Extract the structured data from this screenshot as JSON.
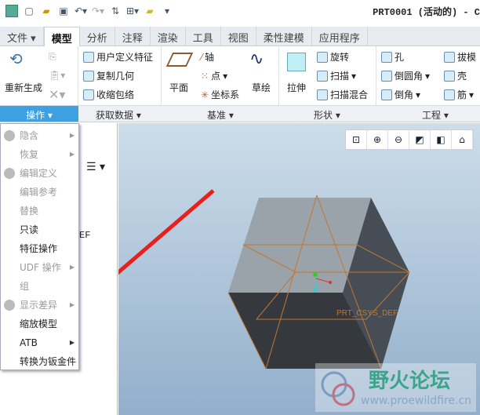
{
  "window": {
    "title": "PRT0001 (活动的) - C"
  },
  "tabs": [
    "文件",
    "模型",
    "分析",
    "注释",
    "渲染",
    "工具",
    "视图",
    "柔性建模",
    "应用程序"
  ],
  "ribbon": {
    "regen": "重新生成",
    "get_data": [
      "用户定义特征",
      "复制几何",
      "收缩包络"
    ],
    "datum": {
      "plane": "平面",
      "axis": "轴",
      "point": "点",
      "csys": "坐标系",
      "sketch": "草绘"
    },
    "shape": {
      "extrude": "拉伸",
      "revolve": "旋转",
      "sweep": "扫描",
      "swept_blend": "扫描混合"
    },
    "eng": {
      "hole": "孔",
      "round": "倒圆角",
      "chamfer": "倒角",
      "draft": "拔模",
      "shell": "壳",
      "rib": "筋"
    }
  },
  "groups": [
    "操作",
    "获取数据",
    "基准",
    "形状",
    "工程"
  ],
  "menu": [
    {
      "label": "隐含",
      "disabled": true,
      "sub": true
    },
    {
      "label": "恢复",
      "disabled": true,
      "sub": true
    },
    {
      "label": "编辑定义",
      "disabled": true
    },
    {
      "label": "编辑参考",
      "disabled": true
    },
    {
      "label": "替换",
      "disabled": true
    },
    {
      "label": "只读"
    },
    {
      "label": "特征操作"
    },
    {
      "label": "UDF 操作",
      "disabled": true,
      "sub": true
    },
    {
      "label": "组",
      "disabled": true
    },
    {
      "label": "显示差异",
      "disabled": true,
      "sub": true
    },
    {
      "label": "缩放模型"
    },
    {
      "label": "ATB",
      "sub": true
    },
    {
      "label": "转换为钣金件"
    }
  ],
  "tree": {
    "partial_text": "EF"
  },
  "viewport": {
    "csys_label": "PRT_CSYS_DEF"
  },
  "watermark": {
    "title": "野火论坛",
    "url": "www.proewildfire.cn"
  },
  "colors": {
    "accent": "#3ea0e0",
    "datum": "#c07830",
    "arrow": "#e8201c"
  }
}
